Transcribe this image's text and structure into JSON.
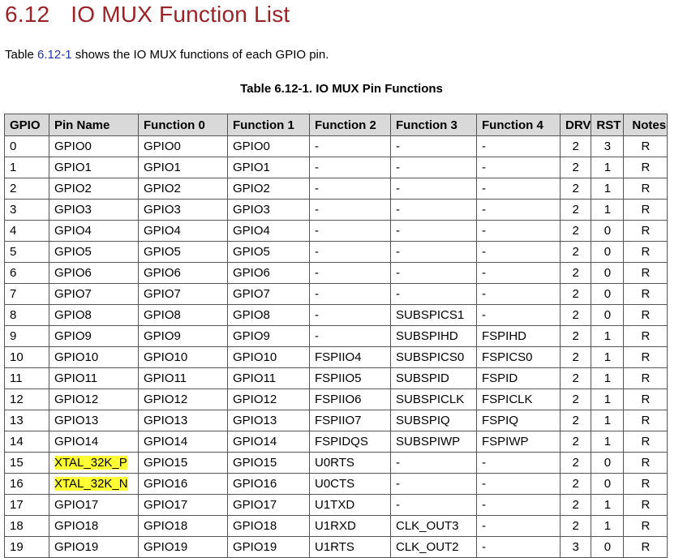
{
  "heading": {
    "number": "6.12",
    "title": "IO MUX Function List"
  },
  "intro": {
    "prefix": "Table ",
    "link": "6.12-1",
    "suffix": " shows the IO MUX functions of each GPIO pin."
  },
  "caption": "Table 6.12-1. IO MUX Pin Functions",
  "highlight_color": "#ffff33",
  "table": {
    "headers": [
      "GPIO",
      "Pin Name",
      "Function 0",
      "Function 1",
      "Function 2",
      "Function 3",
      "Function 4",
      "DRV",
      "RST",
      "Notes"
    ],
    "rows": [
      [
        "0",
        "GPIO0",
        "GPIO0",
        "GPIO0",
        "-",
        "-",
        "-",
        "2",
        "3",
        "R"
      ],
      [
        "1",
        "GPIO1",
        "GPIO1",
        "GPIO1",
        "-",
        "-",
        "-",
        "2",
        "1",
        "R"
      ],
      [
        "2",
        "GPIO2",
        "GPIO2",
        "GPIO2",
        "-",
        "-",
        "-",
        "2",
        "1",
        "R"
      ],
      [
        "3",
        "GPIO3",
        "GPIO3",
        "GPIO3",
        "-",
        "-",
        "-",
        "2",
        "1",
        "R"
      ],
      [
        "4",
        "GPIO4",
        "GPIO4",
        "GPIO4",
        "-",
        "-",
        "-",
        "2",
        "0",
        "R"
      ],
      [
        "5",
        "GPIO5",
        "GPIO5",
        "GPIO5",
        "-",
        "-",
        "-",
        "2",
        "0",
        "R"
      ],
      [
        "6",
        "GPIO6",
        "GPIO6",
        "GPIO6",
        "-",
        "-",
        "-",
        "2",
        "0",
        "R"
      ],
      [
        "7",
        "GPIO7",
        "GPIO7",
        "GPIO7",
        "-",
        "-",
        "-",
        "2",
        "0",
        "R"
      ],
      [
        "8",
        "GPIO8",
        "GPIO8",
        "GPIO8",
        "-",
        "SUBSPICS1",
        "-",
        "2",
        "0",
        "R"
      ],
      [
        "9",
        "GPIO9",
        "GPIO9",
        "GPIO9",
        "-",
        "SUBSPIHD",
        "FSPIHD",
        "2",
        "1",
        "R"
      ],
      [
        "10",
        "GPIO10",
        "GPIO10",
        "GPIO10",
        "FSPIIO4",
        "SUBSPICS0",
        "FSPICS0",
        "2",
        "1",
        "R"
      ],
      [
        "11",
        "GPIO11",
        "GPIO11",
        "GPIO11",
        "FSPIIO5",
        "SUBSPID",
        "FSPID",
        "2",
        "1",
        "R"
      ],
      [
        "12",
        "GPIO12",
        "GPIO12",
        "GPIO12",
        "FSPIIO6",
        "SUBSPICLK",
        "FSPICLK",
        "2",
        "1",
        "R"
      ],
      [
        "13",
        "GPIO13",
        "GPIO13",
        "GPIO13",
        "FSPIIO7",
        "SUBSPIQ",
        "FSPIQ",
        "2",
        "1",
        "R"
      ],
      [
        "14",
        "GPIO14",
        "GPIO14",
        "GPIO14",
        "FSPIDQS",
        "SUBSPIWP",
        "FSPIWP",
        "2",
        "1",
        "R"
      ],
      [
        "15",
        "XTAL_32K_P",
        "GPIO15",
        "GPIO15",
        "U0RTS",
        "-",
        "-",
        "2",
        "0",
        "R"
      ],
      [
        "16",
        "XTAL_32K_N",
        "GPIO16",
        "GPIO16",
        "U0CTS",
        "-",
        "-",
        "2",
        "0",
        "R"
      ],
      [
        "17",
        "GPIO17",
        "GPIO17",
        "GPIO17",
        "U1TXD",
        "-",
        "-",
        "2",
        "1",
        "R"
      ],
      [
        "18",
        "GPIO18",
        "GPIO18",
        "GPIO18",
        "U1RXD",
        "CLK_OUT3",
        "-",
        "2",
        "1",
        "R"
      ],
      [
        "19",
        "GPIO19",
        "GPIO19",
        "GPIO19",
        "U1RTS",
        "CLK_OUT2",
        "-",
        "3",
        "0",
        "R"
      ]
    ],
    "highlighted_pin_names": [
      "XTAL_32K_P",
      "XTAL_32K_N"
    ]
  }
}
